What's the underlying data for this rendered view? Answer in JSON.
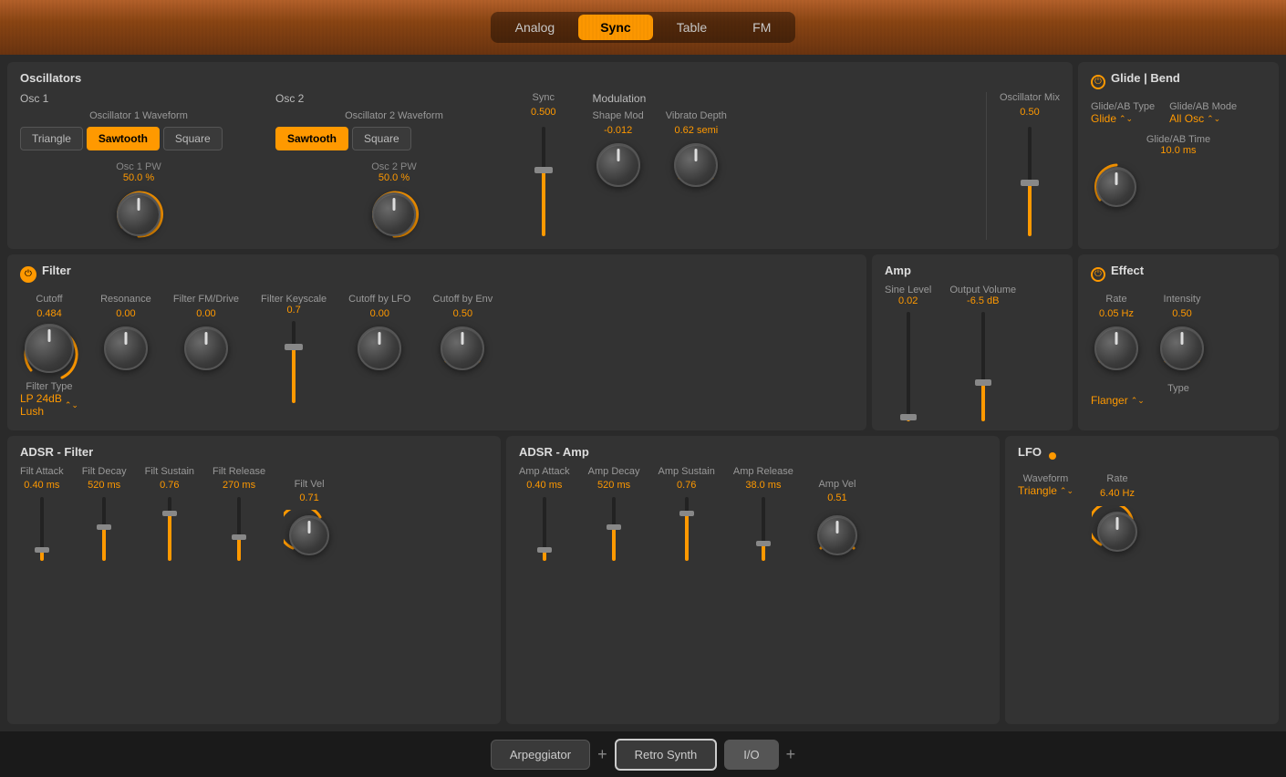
{
  "header": {
    "tabs": [
      {
        "id": "analog",
        "label": "Analog",
        "active": false
      },
      {
        "id": "sync",
        "label": "Sync",
        "active": true
      },
      {
        "id": "table",
        "label": "Table",
        "active": false
      },
      {
        "id": "fm",
        "label": "FM",
        "active": false
      }
    ]
  },
  "oscillators": {
    "title": "Oscillators",
    "osc1": {
      "label": "Osc 1",
      "waveform_label": "Oscillator 1 Waveform",
      "waveforms": [
        "Triangle",
        "Sawtooth",
        "Square"
      ],
      "active_waveform": "Sawtooth",
      "pw_label": "Osc 1 PW",
      "pw_value": "50.0 %"
    },
    "osc2": {
      "label": "Osc 2",
      "waveform_label": "Oscillator 2 Waveform",
      "waveforms": [
        "Sawtooth",
        "Square"
      ],
      "active_waveform": "Sawtooth",
      "pw_label": "Osc 2 PW",
      "pw_value": "50.0 %"
    },
    "sync": {
      "label": "Sync",
      "value": "0.500"
    },
    "modulation": {
      "label": "Modulation",
      "shape_mod_label": "Shape Mod",
      "shape_mod_value": "-0.012",
      "vibrato_depth_label": "Vibrato Depth",
      "vibrato_depth_value": "0.62 semi"
    },
    "osc_mix": {
      "label": "Oscillator Mix",
      "value": "0.50"
    }
  },
  "glide": {
    "title": "Glide | Bend",
    "type_label": "Glide/AB Type",
    "type_value": "Glide",
    "mode_label": "Glide/AB Mode",
    "mode_value": "All Osc",
    "time_label": "Glide/AB Time",
    "time_value": "10.0 ms"
  },
  "filter": {
    "title": "Filter",
    "powered": true,
    "cutoff_label": "Cutoff",
    "cutoff_value": "0.484",
    "resonance_label": "Resonance",
    "resonance_value": "0.00",
    "fm_drive_label": "Filter FM/Drive",
    "fm_drive_value": "0.00",
    "keyscale_label": "Filter Keyscale",
    "keyscale_value": "0.7",
    "cutoff_lfo_label": "Cutoff by LFO",
    "cutoff_lfo_value": "0.00",
    "cutoff_env_label": "Cutoff by Env",
    "cutoff_env_value": "0.50",
    "type_label": "Filter Type",
    "type_value": "LP 24dB\nLush"
  },
  "amp": {
    "title": "Amp",
    "sine_level_label": "Sine Level",
    "sine_level_value": "0.02",
    "output_volume_label": "Output Volume",
    "output_volume_value": "-6.5 dB"
  },
  "effect": {
    "title": "Effect",
    "powered": false,
    "rate_label": "Rate",
    "rate_value": "0.05 Hz",
    "intensity_label": "Intensity",
    "intensity_value": "0.50",
    "type_label": "Type",
    "type_value": "Flanger"
  },
  "adsr_filter": {
    "title": "ADSR - Filter",
    "attack_label": "Filt Attack",
    "attack_value": "0.40 ms",
    "decay_label": "Filt Decay",
    "decay_value": "520 ms",
    "sustain_label": "Filt Sustain",
    "sustain_value": "0.76",
    "release_label": "Filt Release",
    "release_value": "270 ms",
    "vel_label": "Filt Vel",
    "vel_value": "0.71"
  },
  "adsr_amp": {
    "title": "ADSR - Amp",
    "attack_label": "Amp Attack",
    "attack_value": "0.40 ms",
    "decay_label": "Amp Decay",
    "decay_value": "520 ms",
    "sustain_label": "Amp Sustain",
    "sustain_value": "0.76",
    "release_label": "Amp Release",
    "release_value": "38.0 ms",
    "vel_label": "Amp Vel",
    "vel_value": "0.51"
  },
  "lfo": {
    "title": "LFO",
    "waveform_label": "Waveform",
    "waveform_value": "Triangle",
    "rate_label": "Rate",
    "rate_value": "6.40 Hz"
  },
  "taskbar": {
    "arpeggiator_label": "Arpeggiator",
    "retro_synth_label": "Retro Synth",
    "io_label": "I/O",
    "plus": "+"
  }
}
